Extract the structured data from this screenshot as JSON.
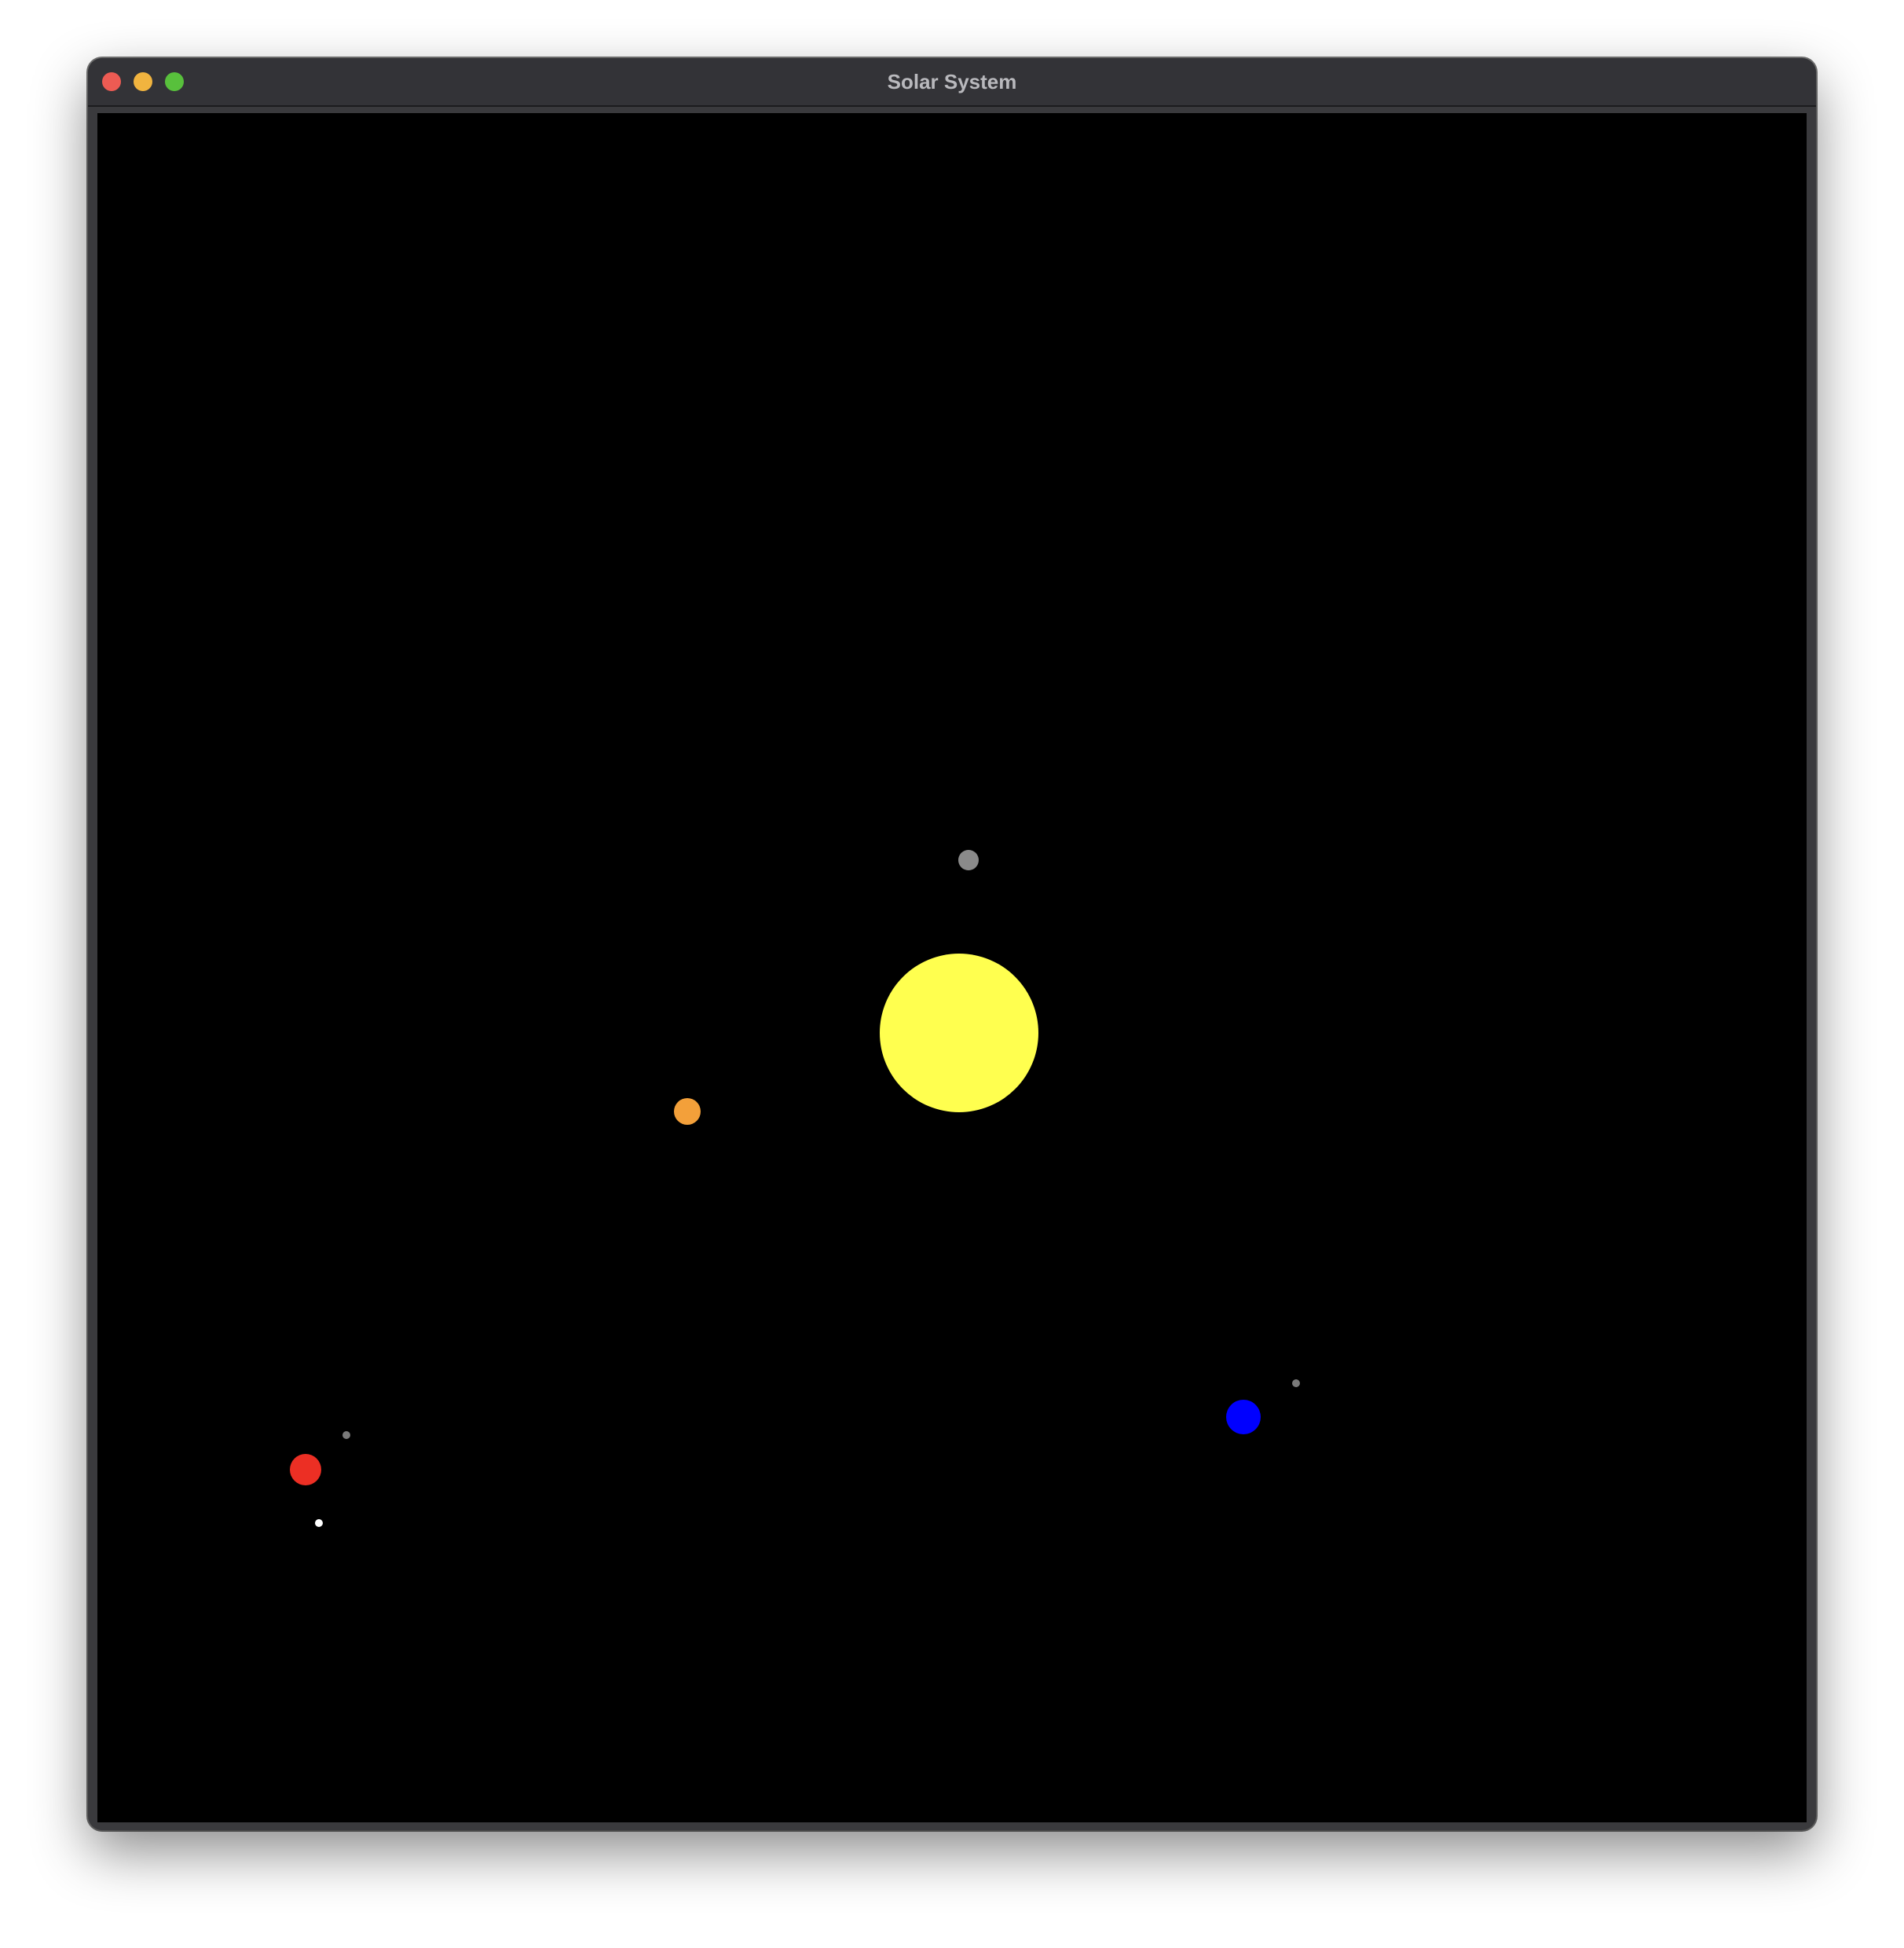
{
  "window": {
    "title": "Solar System",
    "controls": {
      "close_color": "#ed5b53",
      "minimize_color": "#f1b43f",
      "maximize_color": "#58c03c"
    }
  },
  "canvas": {
    "background": "#000000"
  },
  "bodies": [
    {
      "name": "sun",
      "color": "#ffff4f"
    },
    {
      "name": "mercury",
      "color": "#8a8a8a"
    },
    {
      "name": "venus",
      "color": "#f3a03a"
    },
    {
      "name": "earth",
      "color": "#0000ff"
    },
    {
      "name": "earth-moon",
      "color": "#7a7a7a"
    },
    {
      "name": "mars",
      "color": "#ec2f24"
    },
    {
      "name": "mars-moon-grey",
      "color": "#7a7a7a"
    },
    {
      "name": "mars-moon-white",
      "color": "#ffffff"
    }
  ]
}
